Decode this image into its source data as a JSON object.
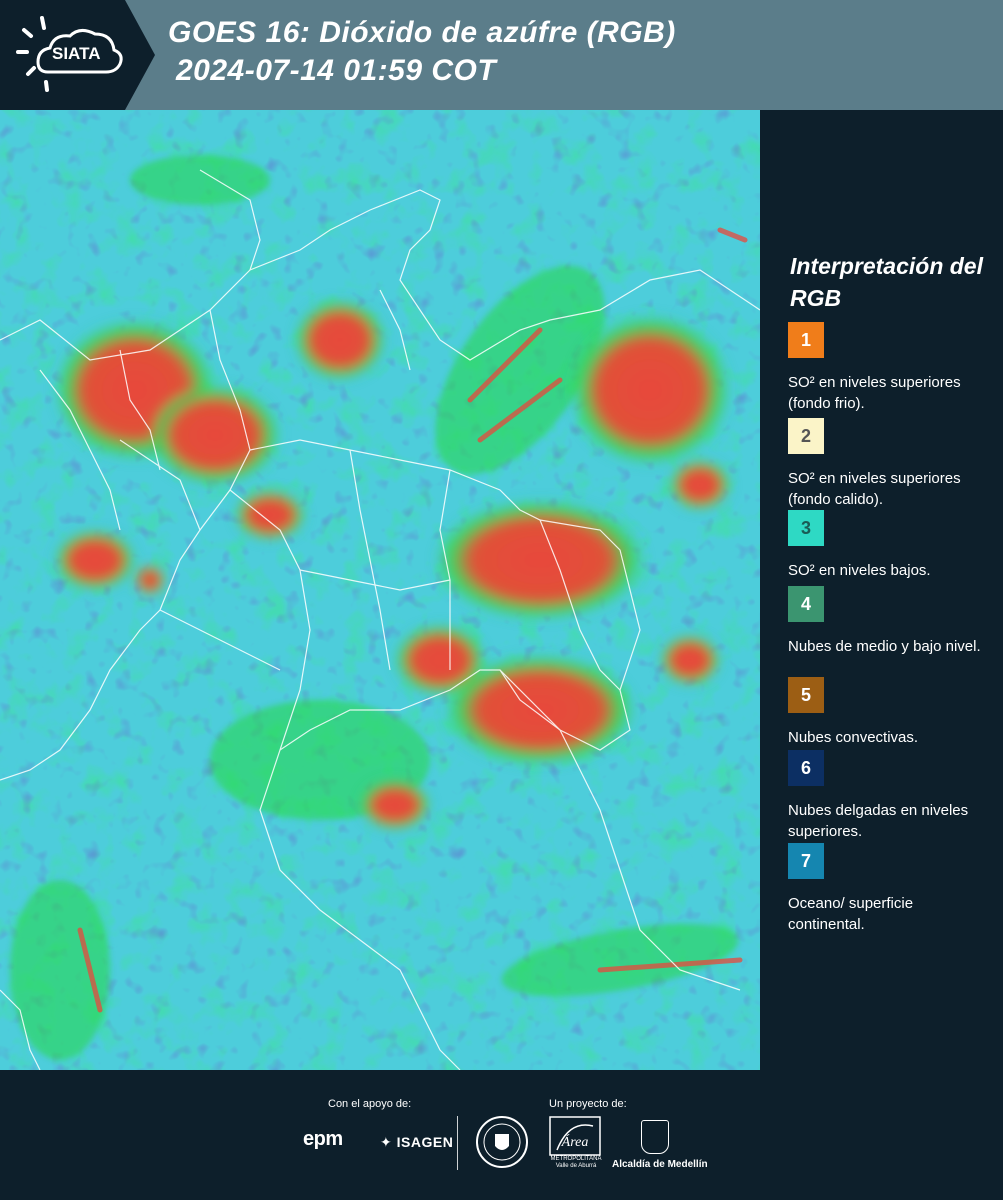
{
  "header": {
    "logo_text": "SIATA",
    "title_line1": "GOES 16: Dióxido de azúfre (RGB)",
    "title_line2": "2024-07-14 01:59 COT",
    "bg_color": "#5b7d8a"
  },
  "map": {
    "description_colors": {
      "background": "#36c4d4",
      "cloud_green": "#22e04a",
      "cloud_red": "#f0483a",
      "dark_blue": "#1d2f9e",
      "borders": "#ffffff"
    }
  },
  "legend": {
    "title": "Interpretación del RGB",
    "items": [
      {
        "number": "1",
        "color": "#f07d1a",
        "text": "SO² en niveles superiores (fondo frio)."
      },
      {
        "number": "2",
        "color": "#fbf4c8",
        "text": "SO² en niveles superiores (fondo calido)."
      },
      {
        "number": "3",
        "color": "#2ed9c4",
        "text": "SO² en niveles bajos."
      },
      {
        "number": "4",
        "color": "#3b9570",
        "text": "Nubes de medio y bajo nivel."
      },
      {
        "number": "5",
        "color": "#9c5e14",
        "text": "Nubes convectivas."
      },
      {
        "number": "6",
        "color": "#0c2f63",
        "text": "Nubes delgadas en niveles superiores."
      },
      {
        "number": "7",
        "color": "#1586b0",
        "text": "Oceano/ superficie continental."
      }
    ]
  },
  "footer": {
    "support_label": "Con el apoyo de:",
    "project_label": "Un proyecto de:",
    "sponsors": [
      "epm",
      "ISAGEN"
    ],
    "partners": {
      "area_name": "Área",
      "area_subtitle": "METROPOLITANA Valle de Aburrá",
      "alcaldia": "Alcaldía de Medellín"
    }
  }
}
